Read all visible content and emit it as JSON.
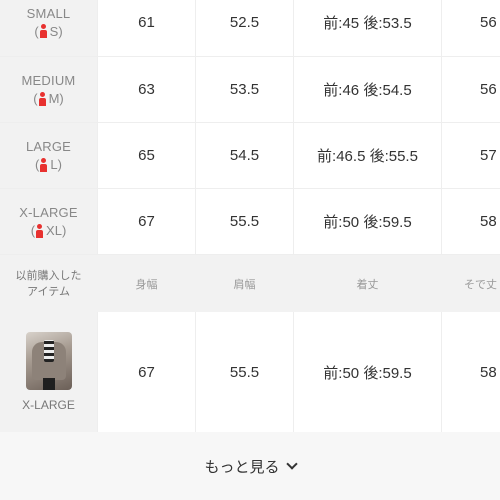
{
  "size_rows": [
    {
      "name": "SMALL",
      "code": "S",
      "values": [
        "61",
        "52.5",
        "前:45 後:53.5",
        "56"
      ]
    },
    {
      "name": "MEDIUM",
      "code": "M",
      "values": [
        "63",
        "53.5",
        "前:46 後:54.5",
        "56"
      ]
    },
    {
      "name": "LARGE",
      "code": "L",
      "values": [
        "65",
        "54.5",
        "前:46.5 後:55.5",
        "57"
      ]
    },
    {
      "name": "X-LARGE",
      "code": "XL",
      "values": [
        "67",
        "55.5",
        "前:50 後:59.5",
        "58"
      ]
    }
  ],
  "history_header": {
    "label": "以前購入した\nアイテム",
    "columns": [
      "身幅",
      "肩幅",
      "着丈",
      "そで丈"
    ]
  },
  "purchased_item": {
    "size_label": "X-LARGE",
    "values": [
      "67",
      "55.5",
      "前:50 後:59.5",
      "58"
    ]
  },
  "more_button": {
    "label": "もっと見る"
  },
  "colors": {
    "accent_icon": "#e8312f",
    "label_bg": "#f2f2f2"
  }
}
